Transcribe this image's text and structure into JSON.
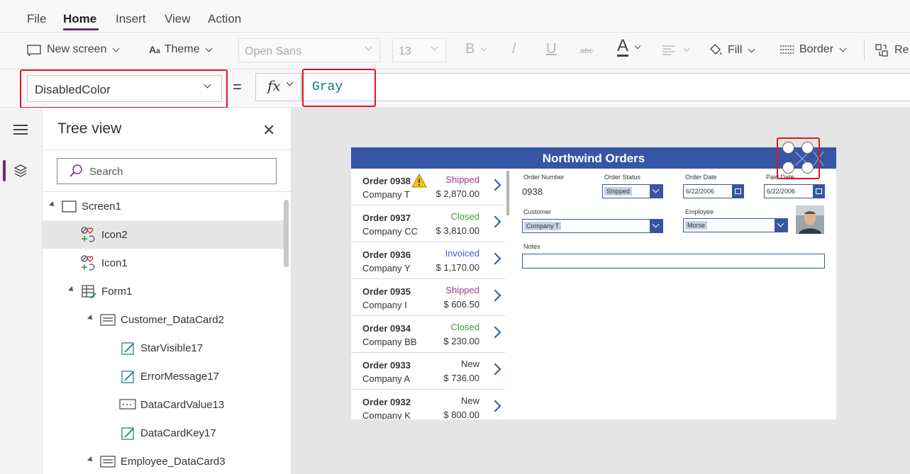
{
  "menu": {
    "file": "File",
    "home": "Home",
    "insert": "Insert",
    "view": "View",
    "action": "Action"
  },
  "toolbar": {
    "new_screen": "New screen",
    "theme": "Theme",
    "font": "Open Sans",
    "font_size": "13",
    "bold": "B",
    "italic": "/",
    "underline": "U",
    "strike": "abc",
    "font_color": "A",
    "fill": "Fill",
    "border": "Border",
    "reorder": "Re"
  },
  "formula": {
    "property": "DisabledColor",
    "equals": "=",
    "fx": "fx",
    "value": "Gray"
  },
  "tree": {
    "title": "Tree view",
    "search_placeholder": "Search",
    "nodes": [
      "Screen1",
      "Icon2",
      "Icon1",
      "Form1",
      "Customer_DataCard2",
      "StarVisible17",
      "ErrorMessage17",
      "DataCardValue13",
      "DataCardKey17",
      "Employee_DataCard3"
    ],
    "selected": "Icon2"
  },
  "app": {
    "title": "Northwind Orders",
    "orders": [
      {
        "number": "Order 0938",
        "company": "Company T",
        "status": "Shipped",
        "amount": "$ 2,870.00",
        "status_color": "#a4379b"
      },
      {
        "number": "Order 0937",
        "company": "Company CC",
        "status": "Closed",
        "amount": "$ 3,810.00",
        "status_color": "#33a033"
      },
      {
        "number": "Order 0936",
        "company": "Company Y",
        "status": "Invoiced",
        "amount": "$ 1,170.00",
        "status_color": "#5151e0"
      },
      {
        "number": "Order 0935",
        "company": "Company I",
        "status": "Shipped",
        "amount": "$ 606.50",
        "status_color": "#a4379b"
      },
      {
        "number": "Order 0934",
        "company": "Company BB",
        "status": "Closed",
        "amount": "$ 230.00",
        "status_color": "#33a033"
      },
      {
        "number": "Order 0933",
        "company": "Company A",
        "status": "New",
        "amount": "$ 736.00",
        "status_color": "#333333"
      },
      {
        "number": "Order 0932",
        "company": "Company K",
        "status": "New",
        "amount": "$ 800.00",
        "status_color": "#333333"
      }
    ],
    "form": {
      "order_number_label": "Order Number",
      "order_number": "0938",
      "order_status_label": "Order Status",
      "order_status": "Shipped",
      "order_date_label": "Order Date",
      "order_date": "6/22/2006",
      "paid_date_label": "Paid Date",
      "paid_date": "6/22/2006",
      "customer_label": "Customer",
      "customer": "Company T",
      "employee_label": "Employee",
      "employee": "Morse",
      "notes_label": "Notes"
    }
  },
  "colors": {
    "accent": "#742774",
    "app_header": "#3655a4",
    "highlight": "#e81123",
    "formula_text": "#0f7b75"
  }
}
